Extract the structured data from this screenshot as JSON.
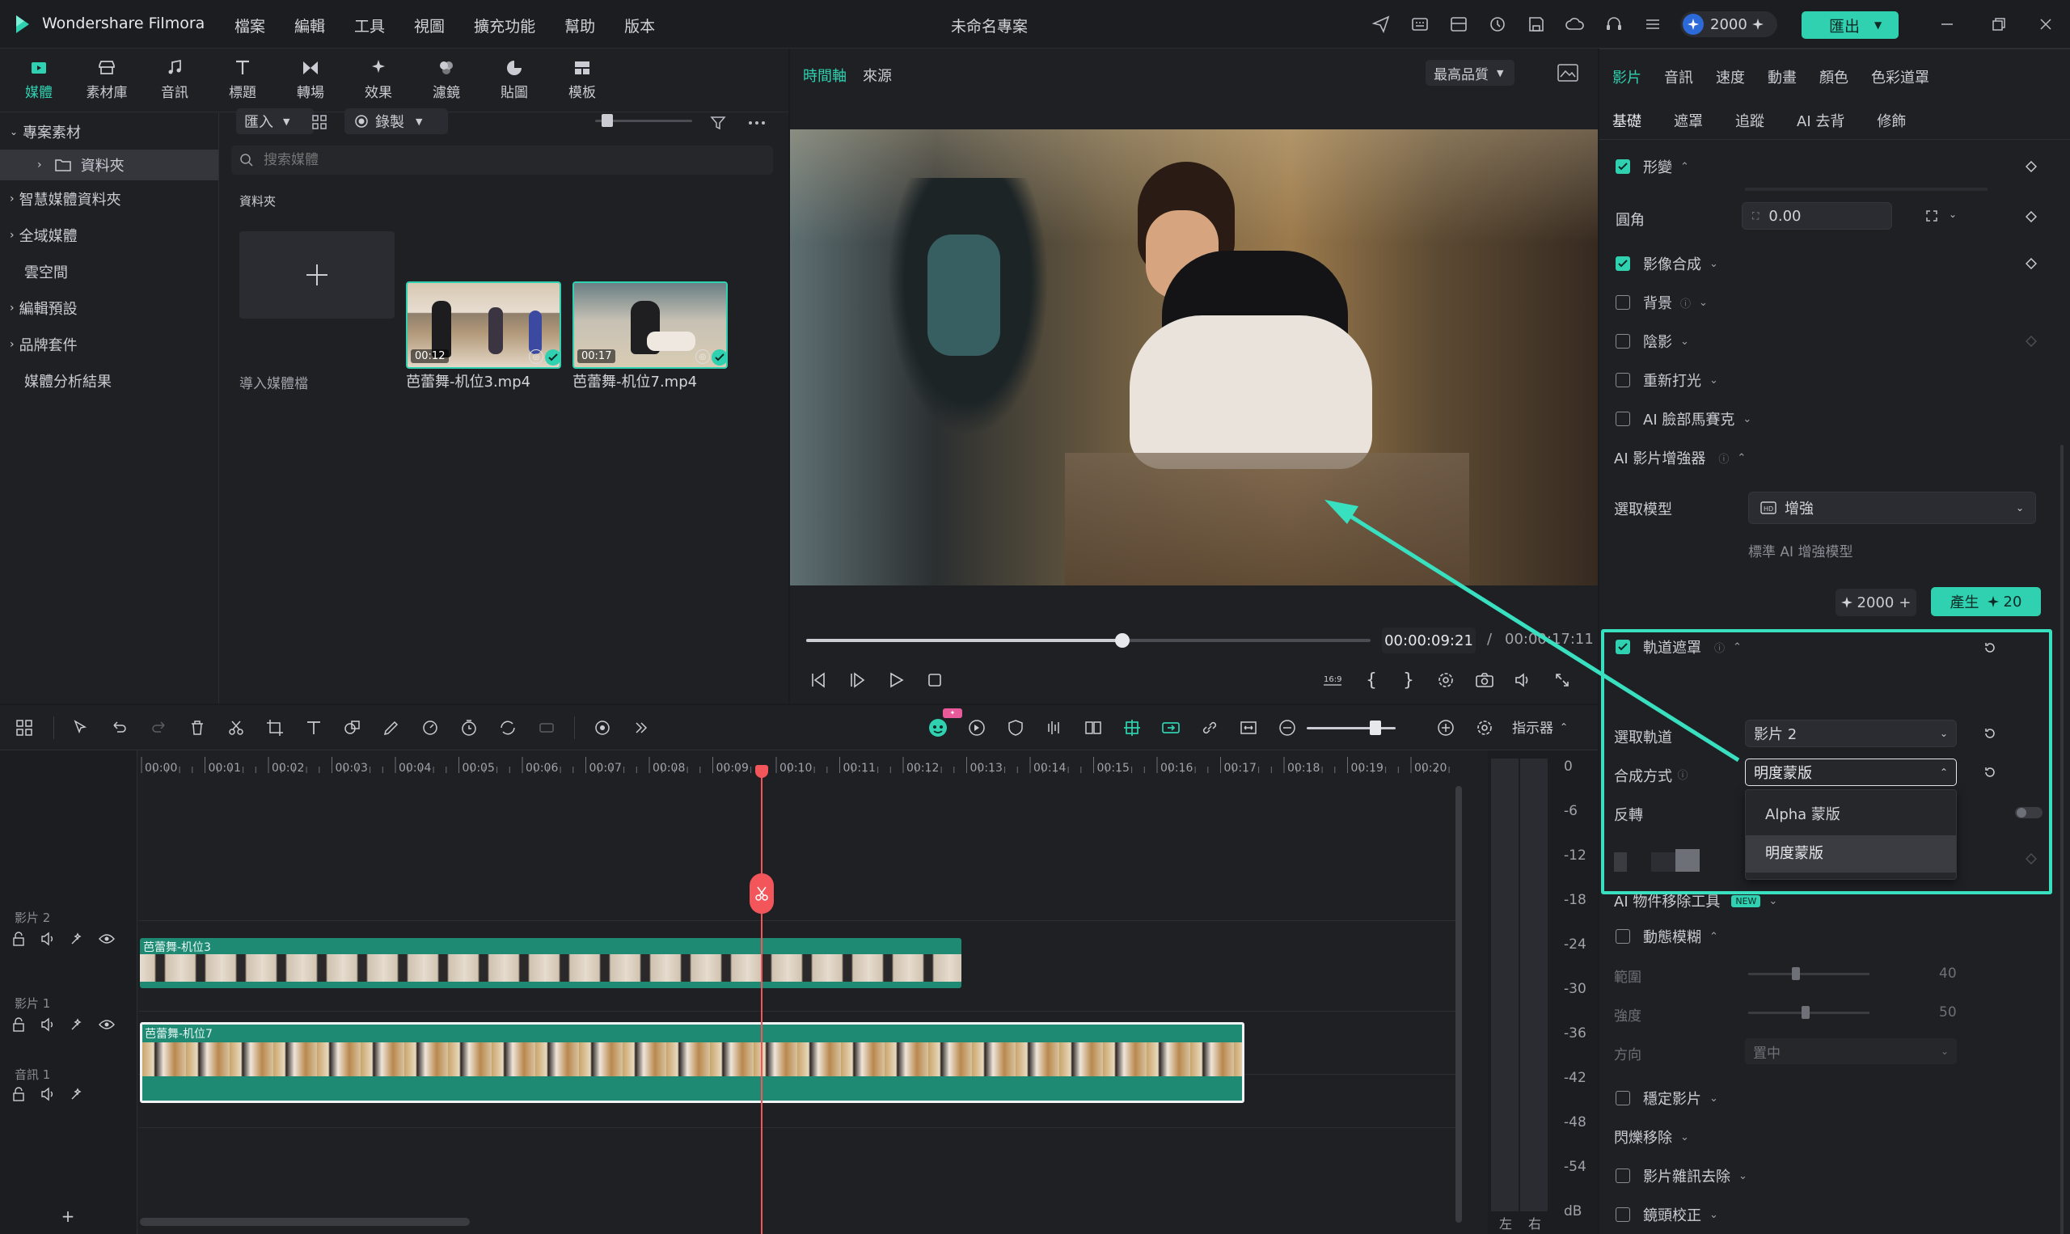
{
  "app": {
    "name": "Wondershare Filmora",
    "project_title": "未命名專案",
    "credits": "2000",
    "export_label": "匯出"
  },
  "menu": [
    "檔案",
    "編輯",
    "工具",
    "視圖",
    "擴充功能",
    "幫助",
    "版本"
  ],
  "media_tools": [
    {
      "label": "媒體",
      "icon": "media-icon"
    },
    {
      "label": "素材庫",
      "icon": "store-icon"
    },
    {
      "label": "音訊",
      "icon": "music-icon"
    },
    {
      "label": "標題",
      "icon": "title-icon"
    },
    {
      "label": "轉場",
      "icon": "transition-icon"
    },
    {
      "label": "效果",
      "icon": "effects-icon"
    },
    {
      "label": "濾鏡",
      "icon": "filter-icon"
    },
    {
      "label": "貼圖",
      "icon": "sticker-icon"
    },
    {
      "label": "模板",
      "icon": "template-icon"
    }
  ],
  "sidebar": {
    "items": [
      "專案素材",
      "資料夾",
      "智慧媒體資料夾",
      "全域媒體",
      "雲空間",
      "編輯預設",
      "品牌套件",
      "媒體分析結果"
    ]
  },
  "media": {
    "import_label": "匯入",
    "record_label": "錄製",
    "search_placeholder": "搜索媒體",
    "folder_heading": "資料夾",
    "import_tile_label": "導入媒體檔",
    "clips": [
      {
        "name": "芭蕾舞-机位3.mp4",
        "duration": "00:12"
      },
      {
        "name": "芭蕾舞-机位7.mp4",
        "duration": "00:17"
      }
    ]
  },
  "player": {
    "tab_timeline": "時間軸",
    "tab_source": "來源",
    "quality": "最高品質",
    "current_time": "00:00:09:21",
    "separator": "/",
    "total_time": "00:00:17:11",
    "progress": 0.56
  },
  "props": {
    "tabs": [
      "影片",
      "音訊",
      "速度",
      "動畫",
      "顏色",
      "色彩道罩"
    ],
    "subtabs": [
      "基礎",
      "遮罩",
      "追蹤",
      "AI 去背",
      "修飾"
    ],
    "transform": "形變",
    "corner": "圓角",
    "corner_value": "0.00",
    "composite": "影像合成",
    "background": "背景",
    "shadow": "陰影",
    "relight": "重新打光",
    "face_mosaic": "AI 臉部馬賽克",
    "ai_enhancer": "AI 影片增強器",
    "select_model": "選取模型",
    "model_value": "增強",
    "model_desc": "標準 AI 增強模型",
    "credits_value": "2000",
    "generate_label": "產生",
    "generate_cost": "20",
    "track_mask": "軌道遮罩",
    "select_track": "選取軌道",
    "track_value": "影片 2",
    "blend_mode": "合成方式",
    "blend_value": "明度蒙版",
    "invert": "反轉",
    "dropdown_options": [
      "Alpha 蒙版",
      "明度蒙版"
    ],
    "ai_remover": "AI 物件移除工具",
    "new_badge": "NEW",
    "motion_blur": "動態模糊",
    "range": "範圍",
    "range_value": "40",
    "strength": "強度",
    "strength_value": "50",
    "direction": "方向",
    "direction_value": "置中",
    "stabilize": "穩定影片",
    "flicker": "閃爍移除",
    "denoise": "影片雜訊去除",
    "lens": "鏡頭校正",
    "reset": "重設"
  },
  "timeline": {
    "indicator_label": "指示器",
    "ruler": [
      "00:00",
      "00:01",
      "00:02",
      "00:03",
      "00:04",
      "00:05",
      "00:06",
      "00:07",
      "00:08",
      "00:09",
      "00:10",
      "00:11",
      "00:12",
      "00:13",
      "00:14",
      "00:15",
      "00:16",
      "00:17",
      "00:18",
      "00:19",
      "00:20"
    ],
    "tracks": [
      {
        "name": "影片 2",
        "clip": "芭蕾舞-机位3"
      },
      {
        "name": "影片 1",
        "clip": "芭蕾舞-机位7"
      },
      {
        "name": "音訊 1",
        "clip": ""
      }
    ],
    "db_scale": [
      "0",
      "-6",
      "-12",
      "-18",
      "-24",
      "-30",
      "-36",
      "-42",
      "-48",
      "-54",
      "dB"
    ],
    "meter_left": "左",
    "meter_right": "右"
  },
  "colors": {
    "accent": "#2fd1b0",
    "playhead": "#f2555a",
    "clip_teal": "#1f8a74"
  }
}
